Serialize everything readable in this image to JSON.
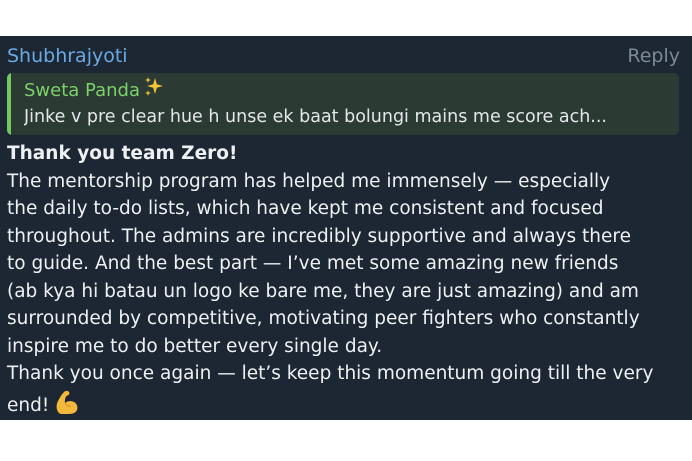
{
  "message": {
    "sender": "Shubhrajyoti",
    "reply_label": "Reply",
    "quote": {
      "author": "Sweta Panda",
      "author_emoji": "sparkles-icon",
      "text": "Jinke v pre clear hue h unse ek baat bolungi mains me score ach..."
    },
    "lines": [
      "Thank you team Zero!",
      "The mentorship program has helped me immensely — especially",
      "the daily to-do lists, which have kept me consistent and focused",
      "throughout. The admins are incredibly supportive and always there",
      "to guide. And the best part — I’ve met some amazing new friends",
      "(ab kya hi batau un logo ke bare me, they are just amazing) and am",
      "surrounded by competitive, motivating peer fighters who constantly",
      "inspire me to do better every single day.",
      "Thank you once again — let’s keep this momentum going till the very",
      "end!"
    ],
    "end_emoji": "flexed-biceps-icon"
  },
  "colors": {
    "bubble_bg": "#1d2733",
    "sender": "#6aa9e3",
    "quote_accent": "#6fc95e",
    "text": "#eef1f3"
  }
}
